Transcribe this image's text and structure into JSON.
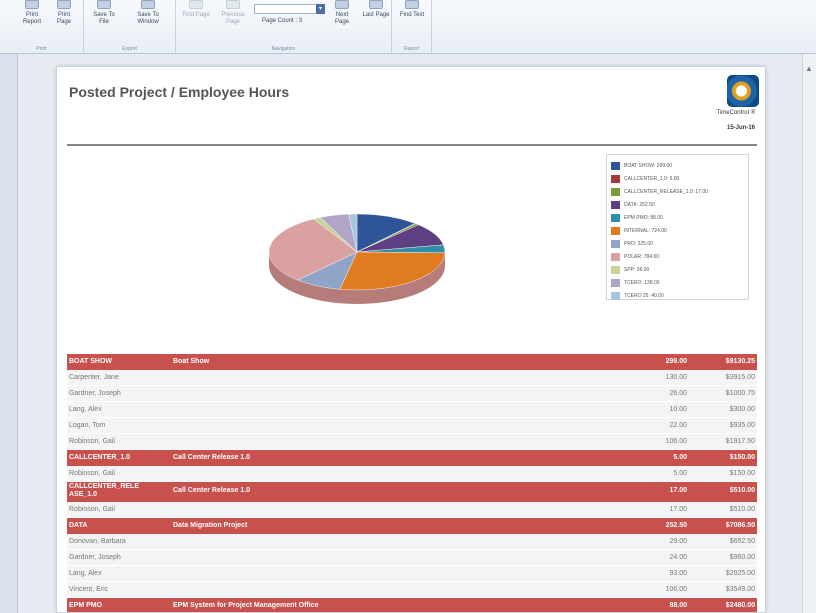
{
  "ribbon": {
    "groups": [
      {
        "caption": "Print",
        "buttons": [
          {
            "label": "Print Report"
          },
          {
            "label": "Print Page"
          }
        ]
      },
      {
        "caption": "Export",
        "buttons": [
          {
            "label": "Save To File"
          },
          {
            "label": "Save To Window"
          }
        ]
      },
      {
        "caption": "Navigation",
        "buttons": [
          {
            "label": "First Page"
          },
          {
            "label": "Previous Page"
          },
          {
            "label": "Next Page"
          },
          {
            "label": "Last Page"
          }
        ],
        "page_count_label": "Page Count : 3"
      },
      {
        "caption": "Report",
        "buttons": [
          {
            "label": "Find Text"
          }
        ]
      }
    ]
  },
  "report": {
    "title": "Posted Project / Employee Hours",
    "brand": "TimeControl ®",
    "date": "15-Jun-16"
  },
  "chart_data": {
    "type": "pie",
    "slices": [
      {
        "label": "BOAT SHOW",
        "value": 299.0,
        "color": "#2e5597"
      },
      {
        "label": "CALLCENTER_1.0",
        "value": 5.0,
        "color": "#a23b3a"
      },
      {
        "label": "CALLCENTER_RELEASE_1.0",
        "value": 17.0,
        "color": "#7a9a3b"
      },
      {
        "label": "DATA",
        "value": 252.5,
        "color": "#5e3f82"
      },
      {
        "label": "EPM PMO",
        "value": 88.0,
        "color": "#2f8fa8"
      },
      {
        "label": "INTERNAL",
        "value": 724.0,
        "color": "#e07b22"
      },
      {
        "label": "PRO",
        "value": 225.0,
        "color": "#8fa4c8"
      },
      {
        "label": "POLAR",
        "value": 784.0,
        "color": "#d9a19f"
      },
      {
        "label": "SPP",
        "value": 36.0,
        "color": "#c6d39b"
      },
      {
        "label": "TCERO",
        "value": 138.0,
        "color": "#b2a4c7"
      },
      {
        "label": "TCERO 25",
        "value": 40.0,
        "color": "#a7c6d9"
      }
    ],
    "legend_entries": [
      "BOAT SHOW: 299.00",
      "CALLCENTER_1.0: 5.00",
      "CALLCENTER_RELEASE_1.0: 17.00",
      "DATA: 252.50",
      "EPM PMO: 88.00",
      "INTERNAL: 724.00",
      "PRO: 225.00",
      "POLAR: 784.00",
      "SPP: 36.00",
      "TCERO: 138.00",
      "TCERO 25: 40.00"
    ],
    "legend_position": "top-right"
  },
  "table": {
    "rows": [
      {
        "kind": "project",
        "code": "BOAT SHOW",
        "name": "Boat Show",
        "hours": "299.00",
        "amount": "$9130.25"
      },
      {
        "kind": "employee",
        "employee": "Carpenter, Jane",
        "hours": "130.00",
        "amount": "$3915.00"
      },
      {
        "kind": "employee",
        "employee": "Gardner, Joseph",
        "hours": "26.00",
        "amount": "$1000.75"
      },
      {
        "kind": "employee",
        "employee": "Lang, Alex",
        "hours": "10.00",
        "amount": "$300.00"
      },
      {
        "kind": "employee",
        "employee": "Logan, Tom",
        "hours": "22.00",
        "amount": "$935.00"
      },
      {
        "kind": "employee",
        "employee": "Robinson, Gail",
        "hours": "106.00",
        "amount": "$1917.50"
      },
      {
        "kind": "project",
        "code": "CALLCENTER_1.0",
        "name": "Call Center Release 1.0",
        "hours": "5.00",
        "amount": "$150.00"
      },
      {
        "kind": "employee",
        "employee": "Robinson, Gail",
        "hours": "5.00",
        "amount": "$150.00"
      },
      {
        "kind": "project",
        "tall": true,
        "code": "CALLCENTER_RELE ASE_1.0",
        "name": "Call Center Release 1.0",
        "hours": "17.00",
        "amount": "$510.00"
      },
      {
        "kind": "employee",
        "employee": "Robinson, Gail",
        "hours": "17.00",
        "amount": "$510.00"
      },
      {
        "kind": "project",
        "code": "DATA",
        "name": "Data Migration Project",
        "hours": "252.50",
        "amount": "$7086.50"
      },
      {
        "kind": "employee",
        "employee": "Donovan, Barbara",
        "hours": "29.00",
        "amount": "$652.50"
      },
      {
        "kind": "employee",
        "employee": "Gardner, Joseph",
        "hours": "24.00",
        "amount": "$960.00"
      },
      {
        "kind": "employee",
        "employee": "Lang, Alex",
        "hours": "93.00",
        "amount": "$2925.00"
      },
      {
        "kind": "employee",
        "employee": "Vincent, Eric",
        "hours": "106.00",
        "amount": "$3549.00"
      },
      {
        "kind": "project",
        "code": "EPM PMO",
        "name": "EPM System for Project Management Office",
        "hours": "88.00",
        "amount": "$2480.00"
      }
    ]
  }
}
